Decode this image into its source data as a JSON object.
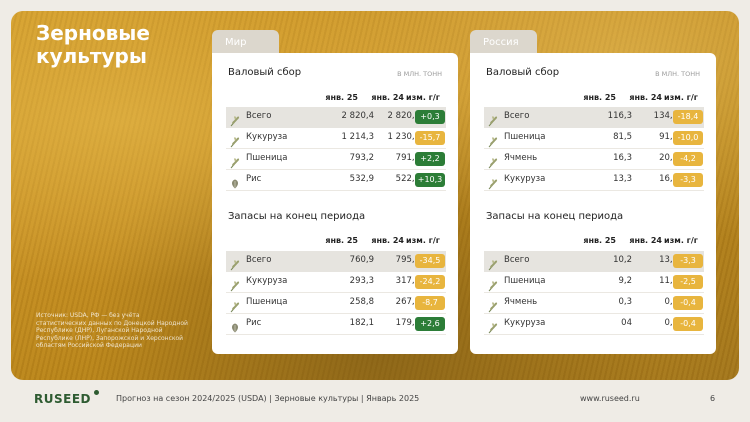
{
  "title": {
    "line1": "Зерновые",
    "line2": "культуры"
  },
  "source_note": "Источник: USDA, РФ — без учёта статистических данных по Донецкой Народной Республике (ДНР), Луганской Народной Республике (ЛНР), Запорожской и Херсонской областям Российской Федерации",
  "colors": {
    "positive": "#2c7d37",
    "negative": "#e8b53e",
    "brand": "#2e5b31"
  },
  "headers": {
    "col1": "янв. 25",
    "col2": "янв. 24",
    "chg": "изм. г/г"
  },
  "world": {
    "tab": "Мир",
    "gross": {
      "title": "Валовый сбор",
      "unit": "В МЛН. ТОНН",
      "rows": [
        {
          "label": "Всего",
          "icon": "wheat-icon",
          "v1": "2 820,4",
          "v2": "2 820,1",
          "chg": "+0,3"
        },
        {
          "label": "Кукуруза",
          "icon": "wheat-icon",
          "v1": "1 214,3",
          "v2": "1 230,0",
          "chg": "-15,7"
        },
        {
          "label": "Пшеница",
          "icon": "wheat-icon",
          "v1": "793,2",
          "v2": "791,0",
          "chg": "+2,2"
        },
        {
          "label": "Рис",
          "icon": "rice-icon",
          "v1": "532,9",
          "v2": "522,6",
          "chg": "+10,3"
        }
      ]
    },
    "stocks": {
      "title": "Запасы на конец периода",
      "rows": [
        {
          "label": "Всего",
          "icon": "wheat-icon",
          "v1": "760,9",
          "v2": "795,4",
          "chg": "-34,5"
        },
        {
          "label": "Кукуруза",
          "icon": "wheat-icon",
          "v1": "293,3",
          "v2": "317,5",
          "chg": "-24,2"
        },
        {
          "label": "Пшеница",
          "icon": "wheat-icon",
          "v1": "258,8",
          "v2": "267,5",
          "chg": "-8,7"
        },
        {
          "label": "Рис",
          "icon": "rice-icon",
          "v1": "182,1",
          "v2": "179,5",
          "chg": "+2,6"
        }
      ]
    }
  },
  "russia": {
    "tab": "Россия",
    "gross": {
      "title": "Валовый сбор",
      "unit": "В МЛН. ТОНН",
      "rows": [
        {
          "label": "Всего",
          "icon": "wheat-icon",
          "v1": "116,3",
          "v2": "134,7",
          "chg": "-18,4"
        },
        {
          "label": "Пшеница",
          "icon": "wheat-icon",
          "v1": "81,5",
          "v2": "91,5",
          "chg": "-10,0"
        },
        {
          "label": "Ячмень",
          "icon": "wheat-icon",
          "v1": "16,3",
          "v2": "20,5",
          "chg": "-4,2"
        },
        {
          "label": "Кукуруза",
          "icon": "wheat-icon",
          "v1": "13,3",
          "v2": "16,6",
          "chg": "-3,3"
        }
      ]
    },
    "stocks": {
      "title": "Запасы на конец периода",
      "rows": [
        {
          "label": "Всего",
          "icon": "wheat-icon",
          "v1": "10,2",
          "v2": "13,5",
          "chg": "-3,3"
        },
        {
          "label": "Пшеница",
          "icon": "wheat-icon",
          "v1": "9,2",
          "v2": "11,7",
          "chg": "-2,5"
        },
        {
          "label": "Ячмень",
          "icon": "wheat-icon",
          "v1": "0,3",
          "v2": "0,7",
          "chg": "-0,4"
        },
        {
          "label": "Кукуруза",
          "icon": "wheat-icon",
          "v1": "04",
          "v2": "0,8",
          "chg": "-0,4"
        }
      ]
    }
  },
  "footer": {
    "logo": "RUSEED",
    "text": "Прогноз на сезон 2024/2025 (USDA)  |  Зерновые культуры  |  Январь 2025",
    "url": "www.ruseed.ru",
    "page": "6"
  }
}
